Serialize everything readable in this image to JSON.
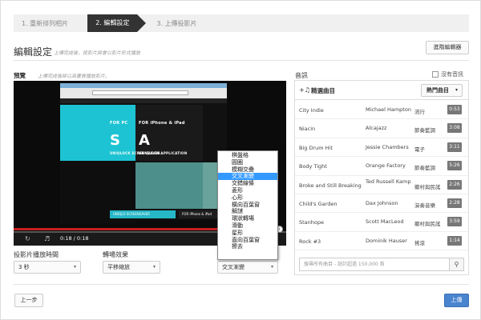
{
  "steps": [
    "1. 重新排列相片",
    "2. 編輯設定",
    "3. 上傳投影片"
  ],
  "header": {
    "title": "編輯設定",
    "subtitle": "上傳完成後，投影片將會以影片形式播放",
    "advanced_button": "進階編輯器"
  },
  "preview": {
    "label": "預覽",
    "hint": "上傳完成後將以高畫質播放影片。",
    "time": "0:18 / 0:18",
    "screen": {
      "pc_label": "FOR PC",
      "ipad_label": "FOR iPhone & iPad",
      "s_letter": "S",
      "a_letter": "A",
      "screensaver": "UNIQLOCK SCREENSAVER",
      "application": "UNIQLOCK APPLICATION",
      "btn_screensaver": "UNIQLO SCREENSAVER",
      "btn_ipad": "FOR iPhone & iPad"
    }
  },
  "controls": {
    "duration_label": "投影片播放時間",
    "duration_value": "3 秒",
    "effect_label": "轉場效果",
    "effect_value": "平移縮放",
    "transition_value": "交叉漸變"
  },
  "transition_options": [
    "棋盤格",
    "圓圈",
    "模糊交疊",
    "交叉漸變",
    "交錯線條",
    "菱形",
    "心形",
    "橫向百葉窗",
    "解謎",
    "環狀轉場",
    "滑動",
    "星形",
    "直向百葉窗",
    "擦去"
  ],
  "transition_selected_index": 3,
  "audio": {
    "title": "音訊",
    "no_audio": "沒有音訊",
    "featured": "精選曲目",
    "hot_button": "熱門曲目",
    "search_placeholder": "搜尋所有曲目 - 說計超過 150,000 首",
    "tracks": [
      {
        "name": "City Indie",
        "artist": "Michael Hampton",
        "genre": "流行",
        "duration": "0:53"
      },
      {
        "name": "Niacin",
        "artist": "Alcajazz",
        "genre": "節奏藍調",
        "duration": "3:08"
      },
      {
        "name": "Big Drum Hit",
        "artist": "Jessie Chambers",
        "genre": "電子",
        "duration": "3:11"
      },
      {
        "name": "Body Tight",
        "artist": "Orange Factory",
        "genre": "節奏藍調",
        "duration": "5:26"
      },
      {
        "name": "Broke and Still Breaking",
        "artist": "Ted Russell Kamp",
        "genre": "鄉村與民謠",
        "duration": "2:26"
      },
      {
        "name": "Child's Garden",
        "artist": "Dax Johnson",
        "genre": "演奏音樂",
        "duration": "2:28"
      },
      {
        "name": "Stanhope",
        "artist": "Scott MacLeod",
        "genre": "鄉村與民謠",
        "duration": "3:59"
      },
      {
        "name": "Rock #3",
        "artist": "Dominik Hauser",
        "genre": "搖滾",
        "duration": "1:14"
      }
    ]
  },
  "footer": {
    "back": "上一步",
    "upload": "上傳"
  },
  "colors": {
    "accent": "#4a84cf",
    "selected": "#3399ff",
    "cyan": "#1dc3d3",
    "progress": "#c82121"
  }
}
